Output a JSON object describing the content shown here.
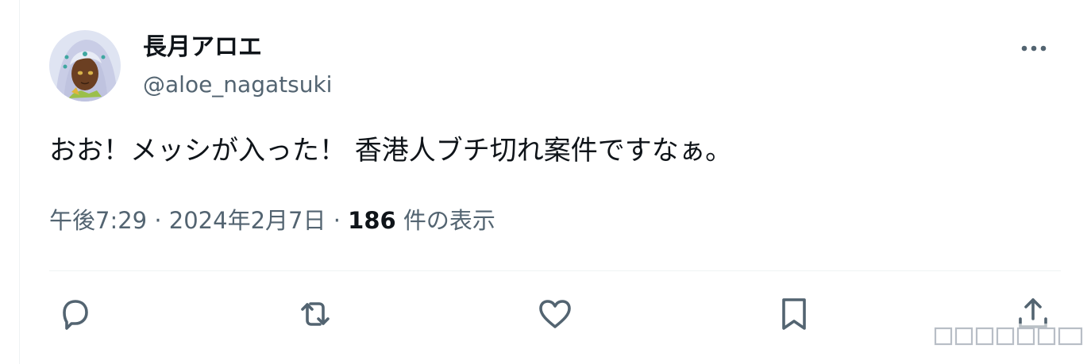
{
  "tweet": {
    "author": {
      "display_name": "長月アロエ",
      "handle": "@aloe_nagatsuki",
      "avatar_icon": "anime-character-avatar"
    },
    "text": "おお！メッシが入った！ 香港人ブチ切れ案件ですなぁ。",
    "time": "午後7:29",
    "date": "2024年2月7日",
    "separator": " · ",
    "view_count": "186",
    "view_label": " 件の表示",
    "more_icon": "ellipsis-icon"
  },
  "actions": [
    {
      "name": "reply",
      "icon": "comment-icon"
    },
    {
      "name": "retweet",
      "icon": "retweet-icon"
    },
    {
      "name": "like",
      "icon": "heart-icon"
    },
    {
      "name": "bookmark",
      "icon": "bookmark-icon"
    },
    {
      "name": "share",
      "icon": "share-icon"
    }
  ],
  "colors": {
    "text_primary": "#0f1419",
    "text_secondary": "#536471",
    "divider": "#eff3f4"
  }
}
